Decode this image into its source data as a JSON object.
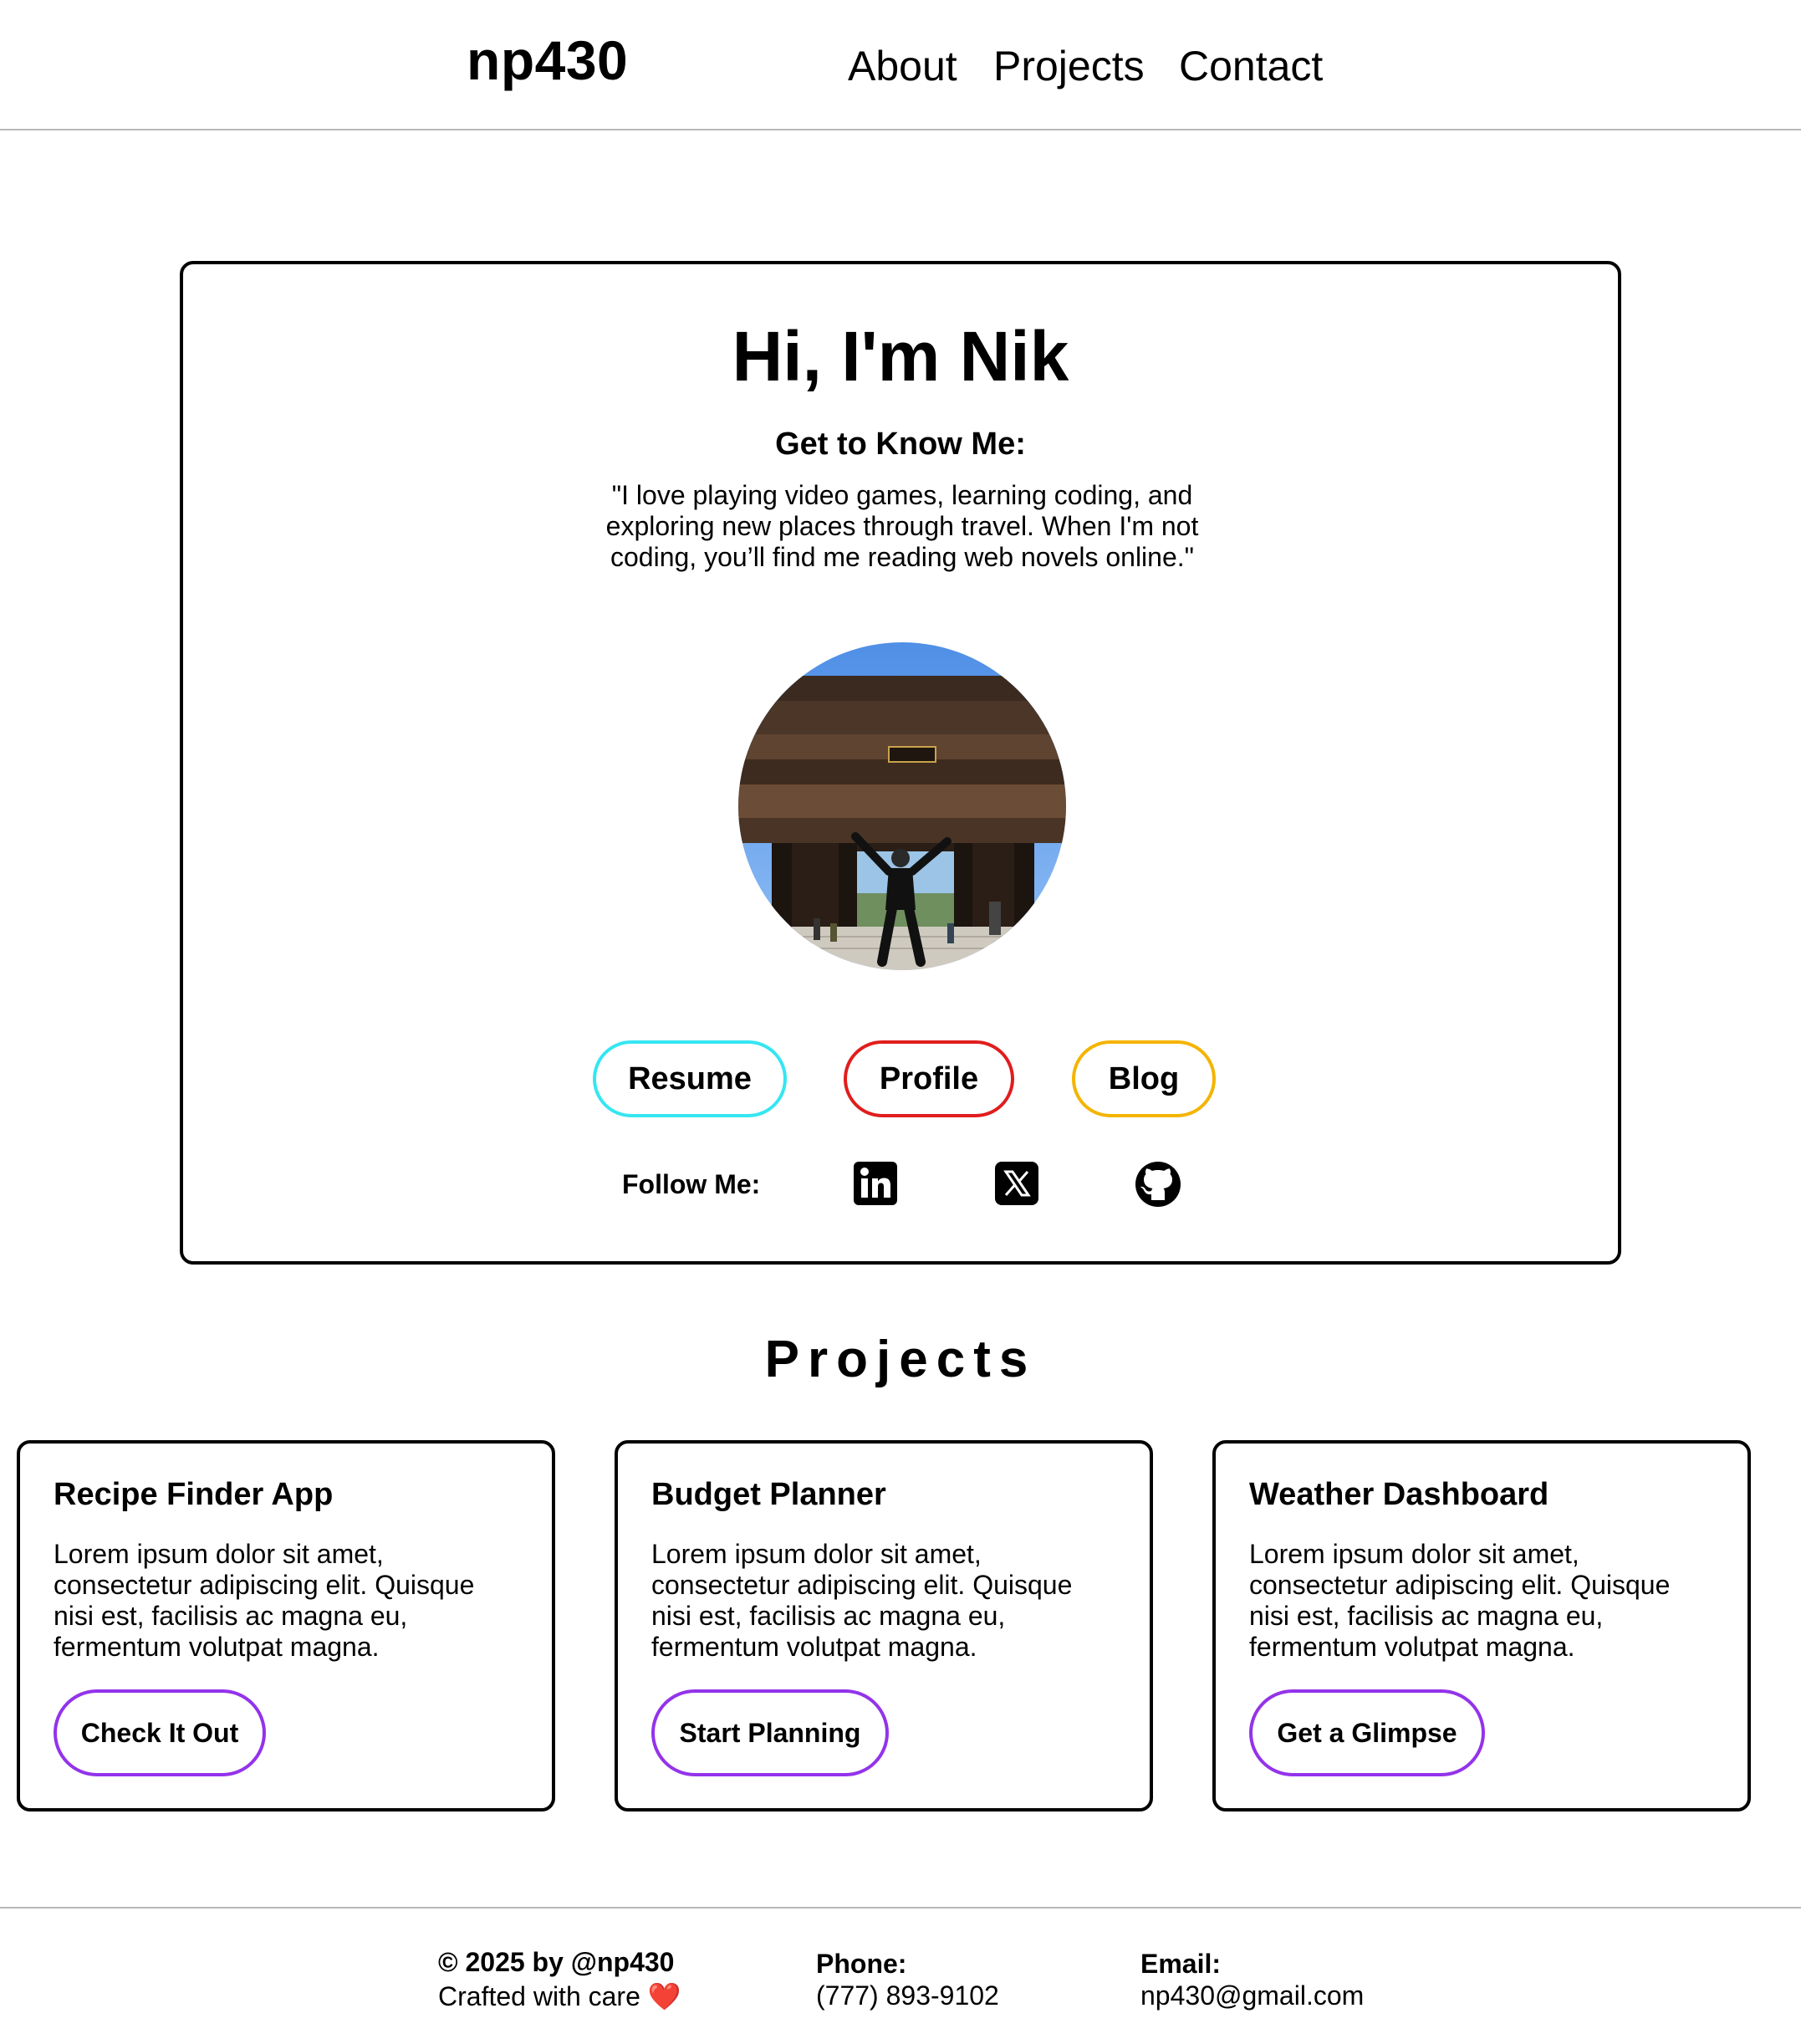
{
  "header": {
    "logo": "np430",
    "nav": [
      "About",
      "Projects",
      "Contact"
    ]
  },
  "hero": {
    "title": "Hi, I'm Nik",
    "subtitle": "Get to Know Me:",
    "quote": "\"I love playing video games, learning coding, and exploring new places through travel. When I'm not coding, you’ll find me reading web novels online.\"",
    "buttons": [
      {
        "label": "Resume",
        "color": "#35e6f2"
      },
      {
        "label": "Profile",
        "color": "#e11d1d"
      },
      {
        "label": "Blog",
        "color": "#f4b400"
      }
    ],
    "follow_label": "Follow Me:",
    "social_icons": [
      "linkedin-icon",
      "x-icon",
      "github-icon"
    ]
  },
  "projects": {
    "title": "Projects",
    "accent": "#9333ea",
    "items": [
      {
        "title": "Recipe Finder App",
        "desc": "Lorem ipsum dolor sit amet, consectetur adipiscing elit. Quisque nisi est, facilisis ac magna eu, fermentum volutpat magna.",
        "button": "Check It Out"
      },
      {
        "title": "Budget Planner",
        "desc": "Lorem ipsum dolor sit amet, consectetur adipiscing elit. Quisque nisi est, facilisis ac magna eu, fermentum volutpat magna.",
        "button": "Start Planning"
      },
      {
        "title": "Weather Dashboard",
        "desc": "Lorem ipsum dolor sit amet, consectetur adipiscing elit. Quisque nisi est, facilisis ac magna eu, fermentum volutpat magna.",
        "button": "Get a Glimpse"
      }
    ]
  },
  "footer": {
    "copyright": "© 2025 by @np430",
    "crafted": "Crafted with care",
    "heart": "❤️",
    "phone_label": "Phone:",
    "phone": "(777) 893-9102",
    "email_label": "Email:",
    "email": "np430@gmail.com"
  }
}
